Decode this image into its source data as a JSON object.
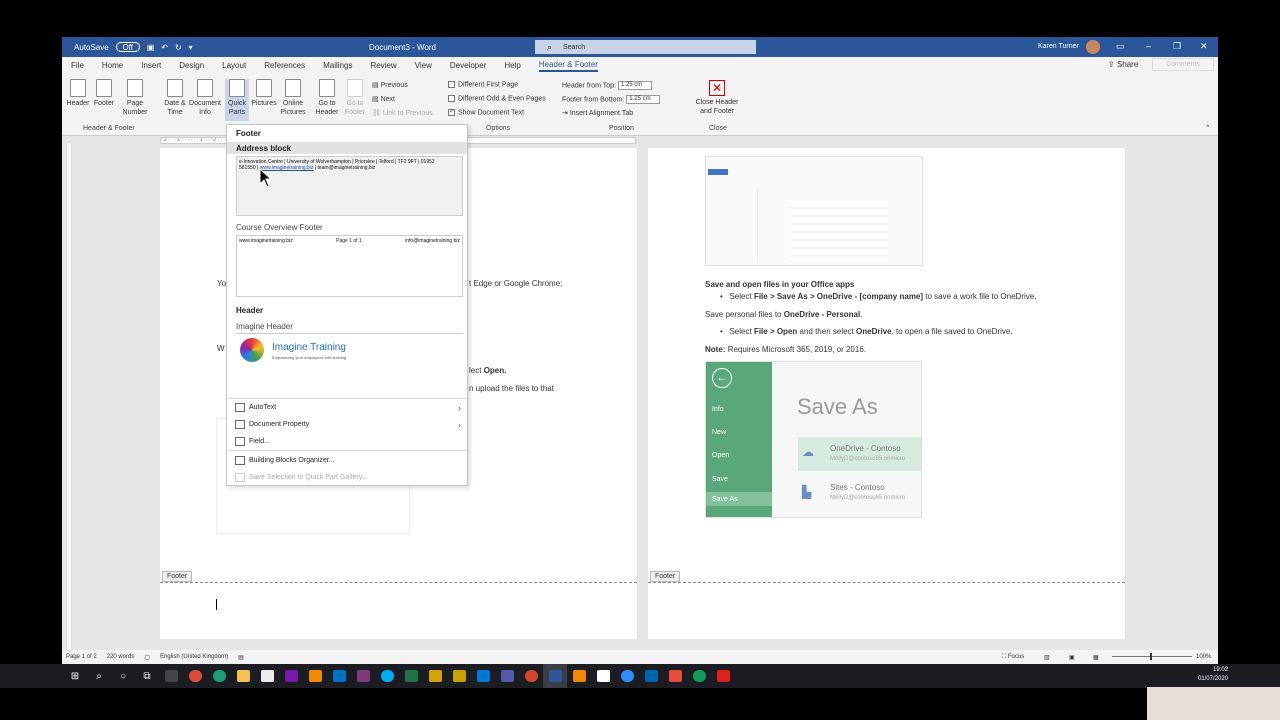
{
  "titlebar": {
    "autosave_label": "AutoSave",
    "autosave_state": "Off",
    "document_title": "Document3 - Word",
    "search_placeholder": "Search",
    "user_name": "Karen Turner"
  },
  "tabs": [
    "File",
    "Home",
    "Insert",
    "Design",
    "Layout",
    "References",
    "Mailings",
    "Review",
    "View",
    "Developer",
    "Help",
    "Header & Footer"
  ],
  "active_tab": "Header & Footer",
  "share_label": "Share",
  "comments_label": "Comments",
  "ribbon": {
    "header": "Header",
    "footer": "Footer",
    "page_number": "Page Number",
    "date_time": "Date & Time",
    "document_info": "Document Info",
    "quick_parts": "Quick Parts",
    "pictures": "Pictures",
    "online_pictures": "Online Pictures",
    "go_to_header": "Go to Header",
    "go_to_footer": "Go to Footer",
    "previous": "Previous",
    "next": "Next",
    "link_to_previous": "Link to Previous",
    "different_first_page": "Different First Page",
    "different_odd_even": "Different Odd & Even Pages",
    "show_document_text": "Show Document Text",
    "header_from_top": "Header from Top:",
    "header_from_top_value": "1.25 cm",
    "footer_from_bottom": "Footer from Bottom:",
    "footer_from_bottom_value": "1.25 cm",
    "insert_alignment_tab": "Insert Alignment Tab",
    "close_header_footer": "Close Header and Footer",
    "group_header_footer": "Header & Footer",
    "group_options": "Options",
    "group_position": "Position",
    "group_close": "Close"
  },
  "dropdown": {
    "section_footer": "Footer",
    "address_block_title": "Address block",
    "address_block_text_line1": "e-Innovation Centre | University of Wolverhampton | Priorslee | Telford | TF2 9FT | 01952",
    "address_block_text_line2_num": "581550 |",
    "address_block_link": "www.imaginetraining.biz",
    "address_block_email": "| team@imaginetraining.biz",
    "course_overview_title": "Course Overview Footer",
    "course_left": "www.imaginetraining.biz",
    "course_mid": "Page 1 of 1",
    "course_right": "info@imaginetraining.biz",
    "section_header": "Header",
    "imagine_header_title": "Imagine Header",
    "logo_text": "Imagine Training",
    "logo_tagline": "Empowering your employees with training",
    "menu": {
      "autotext": "AutoText",
      "document_property": "Document Property",
      "field": "Field...",
      "building_blocks": "Building Blocks Organizer...",
      "save_selection": "Save Selection to Quick Part Gallery..."
    }
  },
  "page1": {
    "partial_text1": "Yo",
    "partial_text2": "t Edge or Google Chrome:",
    "partial_text3": "W",
    "partial_text4": "lect",
    "partial_text4_bold": "Open.",
    "partial_text5": "n upload the files to that",
    "footer_label": "Footer"
  },
  "page2": {
    "heading": "Save and open files in your Office apps",
    "bullet1_pre": "Select",
    "bullet1_bold": "File > Save As > OneDrive - [company name]",
    "bullet1_post": "to save a work file to OneDrive.",
    "line2_pre": "Save personal files to",
    "line2_bold": "OneDrive - Personal",
    "line2_post": ".",
    "bullet2_pre": "Select",
    "bullet2_bold1": "File > Open",
    "bullet2_mid": "and then select",
    "bullet2_bold2": "OneDrive",
    "bullet2_post": ", to open a file saved to OneDrive.",
    "note_bold": "Note:",
    "note_text": "Requires Microsoft 365, 2019, or 2016.",
    "saveas_title": "Save As",
    "saveas_menu": [
      "Info",
      "New",
      "Open",
      "Save",
      "Save As"
    ],
    "saveas_item1": "OneDrive - Contoso",
    "saveas_item1_sub": "MollyD@contoso85.onmicro",
    "saveas_item2": "Sites - Contoso",
    "saveas_item2_sub": "MollyD@contoso85.onmicro",
    "footer_label": "Footer"
  },
  "status": {
    "page": "Page 1 of 2",
    "words": "220 words",
    "language": "English (United Kingdom)",
    "focus": "Focus",
    "zoom": "100%"
  },
  "clock": {
    "time": "19:02",
    "date": "01/07/2020"
  },
  "colors": {
    "word_blue": "#2b579a",
    "saveas_green": "#217346"
  }
}
